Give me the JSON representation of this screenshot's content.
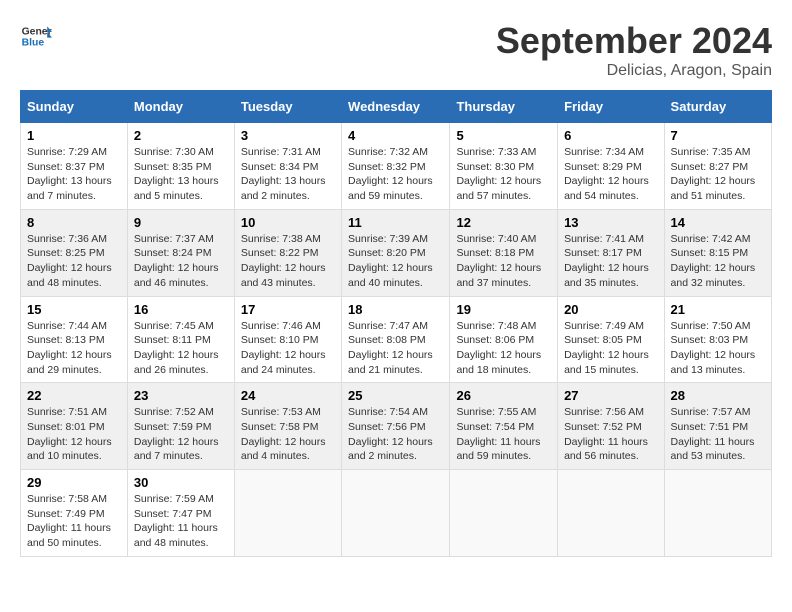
{
  "header": {
    "logo_general": "General",
    "logo_blue": "Blue",
    "month_title": "September 2024",
    "location": "Delicias, Aragon, Spain"
  },
  "weekdays": [
    "Sunday",
    "Monday",
    "Tuesday",
    "Wednesday",
    "Thursday",
    "Friday",
    "Saturday"
  ],
  "weeks": [
    [
      {
        "day": "1",
        "sunrise": "7:29 AM",
        "sunset": "8:37 PM",
        "daylight": "13 hours and 7 minutes."
      },
      {
        "day": "2",
        "sunrise": "7:30 AM",
        "sunset": "8:35 PM",
        "daylight": "13 hours and 5 minutes."
      },
      {
        "day": "3",
        "sunrise": "7:31 AM",
        "sunset": "8:34 PM",
        "daylight": "13 hours and 2 minutes."
      },
      {
        "day": "4",
        "sunrise": "7:32 AM",
        "sunset": "8:32 PM",
        "daylight": "12 hours and 59 minutes."
      },
      {
        "day": "5",
        "sunrise": "7:33 AM",
        "sunset": "8:30 PM",
        "daylight": "12 hours and 57 minutes."
      },
      {
        "day": "6",
        "sunrise": "7:34 AM",
        "sunset": "8:29 PM",
        "daylight": "12 hours and 54 minutes."
      },
      {
        "day": "7",
        "sunrise": "7:35 AM",
        "sunset": "8:27 PM",
        "daylight": "12 hours and 51 minutes."
      }
    ],
    [
      {
        "day": "8",
        "sunrise": "7:36 AM",
        "sunset": "8:25 PM",
        "daylight": "12 hours and 48 minutes."
      },
      {
        "day": "9",
        "sunrise": "7:37 AM",
        "sunset": "8:24 PM",
        "daylight": "12 hours and 46 minutes."
      },
      {
        "day": "10",
        "sunrise": "7:38 AM",
        "sunset": "8:22 PM",
        "daylight": "12 hours and 43 minutes."
      },
      {
        "day": "11",
        "sunrise": "7:39 AM",
        "sunset": "8:20 PM",
        "daylight": "12 hours and 40 minutes."
      },
      {
        "day": "12",
        "sunrise": "7:40 AM",
        "sunset": "8:18 PM",
        "daylight": "12 hours and 37 minutes."
      },
      {
        "day": "13",
        "sunrise": "7:41 AM",
        "sunset": "8:17 PM",
        "daylight": "12 hours and 35 minutes."
      },
      {
        "day": "14",
        "sunrise": "7:42 AM",
        "sunset": "8:15 PM",
        "daylight": "12 hours and 32 minutes."
      }
    ],
    [
      {
        "day": "15",
        "sunrise": "7:44 AM",
        "sunset": "8:13 PM",
        "daylight": "12 hours and 29 minutes."
      },
      {
        "day": "16",
        "sunrise": "7:45 AM",
        "sunset": "8:11 PM",
        "daylight": "12 hours and 26 minutes."
      },
      {
        "day": "17",
        "sunrise": "7:46 AM",
        "sunset": "8:10 PM",
        "daylight": "12 hours and 24 minutes."
      },
      {
        "day": "18",
        "sunrise": "7:47 AM",
        "sunset": "8:08 PM",
        "daylight": "12 hours and 21 minutes."
      },
      {
        "day": "19",
        "sunrise": "7:48 AM",
        "sunset": "8:06 PM",
        "daylight": "12 hours and 18 minutes."
      },
      {
        "day": "20",
        "sunrise": "7:49 AM",
        "sunset": "8:05 PM",
        "daylight": "12 hours and 15 minutes."
      },
      {
        "day": "21",
        "sunrise": "7:50 AM",
        "sunset": "8:03 PM",
        "daylight": "12 hours and 13 minutes."
      }
    ],
    [
      {
        "day": "22",
        "sunrise": "7:51 AM",
        "sunset": "8:01 PM",
        "daylight": "12 hours and 10 minutes."
      },
      {
        "day": "23",
        "sunrise": "7:52 AM",
        "sunset": "7:59 PM",
        "daylight": "12 hours and 7 minutes."
      },
      {
        "day": "24",
        "sunrise": "7:53 AM",
        "sunset": "7:58 PM",
        "daylight": "12 hours and 4 minutes."
      },
      {
        "day": "25",
        "sunrise": "7:54 AM",
        "sunset": "7:56 PM",
        "daylight": "12 hours and 2 minutes."
      },
      {
        "day": "26",
        "sunrise": "7:55 AM",
        "sunset": "7:54 PM",
        "daylight": "11 hours and 59 minutes."
      },
      {
        "day": "27",
        "sunrise": "7:56 AM",
        "sunset": "7:52 PM",
        "daylight": "11 hours and 56 minutes."
      },
      {
        "day": "28",
        "sunrise": "7:57 AM",
        "sunset": "7:51 PM",
        "daylight": "11 hours and 53 minutes."
      }
    ],
    [
      {
        "day": "29",
        "sunrise": "7:58 AM",
        "sunset": "7:49 PM",
        "daylight": "11 hours and 50 minutes."
      },
      {
        "day": "30",
        "sunrise": "7:59 AM",
        "sunset": "7:47 PM",
        "daylight": "11 hours and 48 minutes."
      },
      null,
      null,
      null,
      null,
      null
    ]
  ],
  "labels": {
    "sunrise": "Sunrise:",
    "sunset": "Sunset:",
    "daylight": "Daylight:"
  }
}
